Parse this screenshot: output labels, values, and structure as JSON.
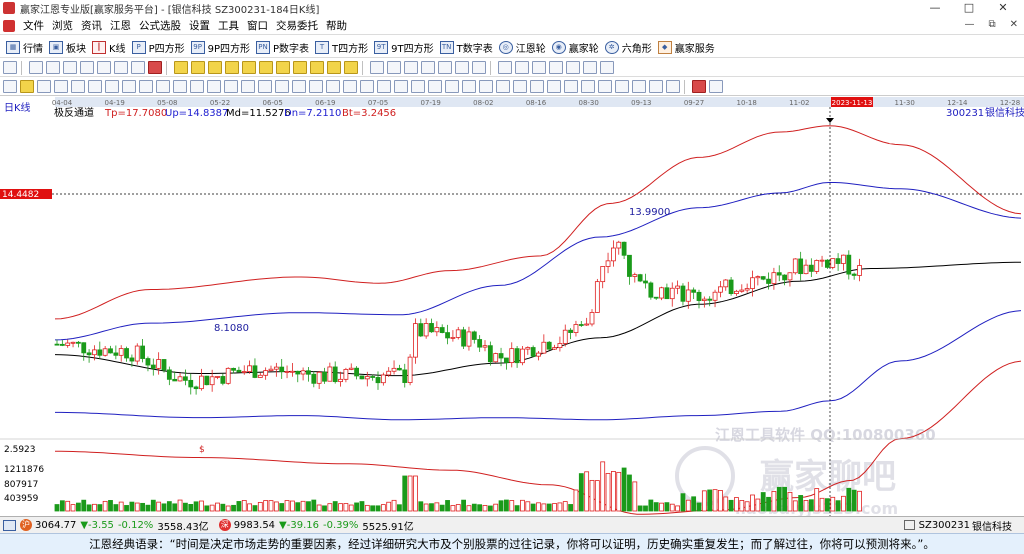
{
  "window": {
    "title": "赢家江恩专业版[赢家服务平台] - [银信科技  SZ300231-184日K线]",
    "controls": [
      "—",
      "□",
      "✕"
    ]
  },
  "menu": {
    "items": [
      "文件",
      "浏览",
      "资讯",
      "江恩",
      "公式选股",
      "设置",
      "工具",
      "窗口",
      "交易委托",
      "帮助"
    ],
    "mdi_controls": [
      "—",
      "⧉",
      "✕"
    ]
  },
  "toolbar1": {
    "items": [
      {
        "label": "行情",
        "icon": "grid-icon"
      },
      {
        "label": "板块",
        "icon": "blocks-icon"
      },
      {
        "label": "K线",
        "icon": "kline-icon"
      },
      {
        "label": "P四方形",
        "icon": "square-p-icon"
      },
      {
        "label": "9P四方形",
        "icon": "square-9p-icon"
      },
      {
        "label": "P数字表",
        "icon": "table-p-icon"
      },
      {
        "label": "T四方形",
        "icon": "square-t-icon"
      },
      {
        "label": "9T四方形",
        "icon": "square-9t-icon"
      },
      {
        "label": "T数字表",
        "icon": "table-t-icon"
      },
      {
        "label": "江恩轮",
        "icon": "wheel-icon"
      },
      {
        "label": "赢家轮",
        "icon": "winner-wheel-icon"
      },
      {
        "label": "六角形",
        "icon": "hexagon-icon"
      },
      {
        "label": "赢家服务",
        "icon": "service-icon"
      }
    ]
  },
  "chart": {
    "date_axis": [
      "04-04",
      "04-19",
      "05-08",
      "05-22",
      "06-05",
      "06-19",
      "07-05",
      "07-19",
      "08-02",
      "08-16",
      "08-30",
      "09-13",
      "09-27",
      "10-18",
      "11-02",
      "2023-11-13",
      "11-30",
      "12-14",
      "12-28"
    ],
    "period_label": "日K线",
    "indicator_name": "极反通道",
    "indicators": [
      {
        "text": "Tp=17.7080",
        "color": "#d02020"
      },
      {
        "text": "Up=14.8387",
        "color": "#2020d0"
      },
      {
        "text": "Md=11.5276",
        "color": "#000000"
      },
      {
        "text": "Dn=7.2110",
        "color": "#2020d0"
      },
      {
        "text": "Bt=3.2456",
        "color": "#d02020"
      }
    ],
    "stock_code": "300231",
    "stock_name": "银信科技",
    "price_tag": "14.4482",
    "price_annotations": {
      "high": "13.9900",
      "low": "8.1080"
    },
    "volume_axis_labels": [
      "2.5923",
      "1211876",
      "807917",
      "403959"
    ],
    "watermark_line1": "江恩工具软件   QQ:100800360",
    "watermark_line2": "赢家聊吧",
    "watermark_line3": "liaoba.yjs123.com",
    "colors": {
      "up": "#e02020",
      "down": "#1a9a1a",
      "top_band": "#d02020",
      "mid_band": "#2020c0",
      "md_line": "#000000",
      "cursor": "#000000",
      "price_tag_bg": "#e01010"
    }
  },
  "status": {
    "index1": {
      "value": "3064.77",
      "change": "▼-3.55",
      "pct": "-0.12%",
      "amount": "3558.43亿"
    },
    "index2": {
      "value": "9983.54",
      "change": "▼-39.16",
      "pct": "-0.39%",
      "amount": "5525.91亿"
    },
    "right_code": "SZ300231",
    "right_name": "银信科技"
  },
  "quote": {
    "text": "江恩经典语录：“时间是决定市场走势的重要因素，经过详细研究大市及个别股票的过往记录，你将可以证明，历史确实重复发生；而了解过往，你将可以预测将来。”。"
  }
}
